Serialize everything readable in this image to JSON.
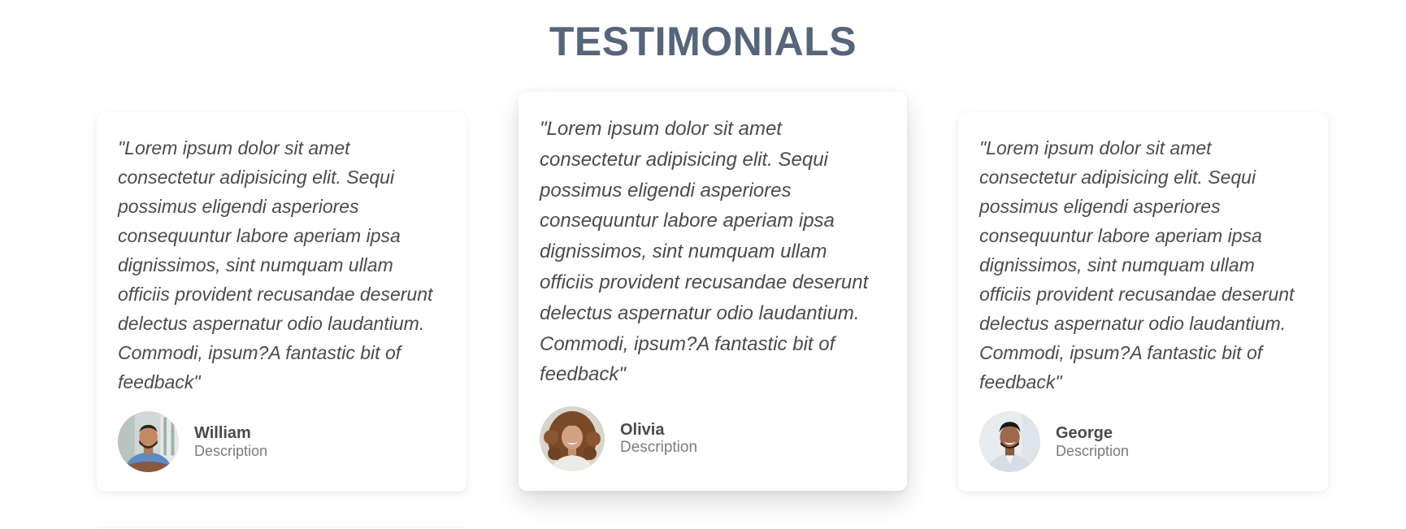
{
  "section": {
    "title": "TESTIMONIALS"
  },
  "testimonials": [
    {
      "quote": "\"Lorem ipsum dolor sit amet consectetur adipisicing elit. Sequi possimus eligendi asperiores consequuntur labore aperiam ipsa dignissimos, sint numquam ullam officiis provident recusandae deserunt delectus aspernatur odio laudantium. Commodi, ipsum?A fantastic bit of feedback\"",
      "name": "William",
      "description": "Description",
      "avatar_icon": "man-with-beard-avatar"
    },
    {
      "quote": "\"Lorem ipsum dolor sit amet consectetur adipisicing elit. Sequi possimus eligendi asperiores consequuntur labore aperiam ipsa dignissimos, sint numquam ullam officiis provident recusandae deserunt delectus aspernatur odio laudantium. Commodi, ipsum?A fantastic bit of feedback\"",
      "name": "Olivia",
      "description": "Description",
      "avatar_icon": "woman-curly-hair-avatar"
    },
    {
      "quote": "\"Lorem ipsum dolor sit amet consectetur adipisicing elit. Sequi possimus eligendi asperiores consequuntur labore aperiam ipsa dignissimos, sint numquam ullam officiis provident recusandae deserunt delectus aspernatur odio laudantium. Commodi, ipsum?A fantastic bit of feedback\"",
      "name": "George",
      "description": "Description",
      "avatar_icon": "smiling-man-avatar"
    }
  ],
  "colors": {
    "title": "#56657a",
    "quote_text": "#4b4b4b",
    "name_text": "#4a4a4a",
    "description_text": "#7b7b7b",
    "card_background": "#ffffff"
  }
}
